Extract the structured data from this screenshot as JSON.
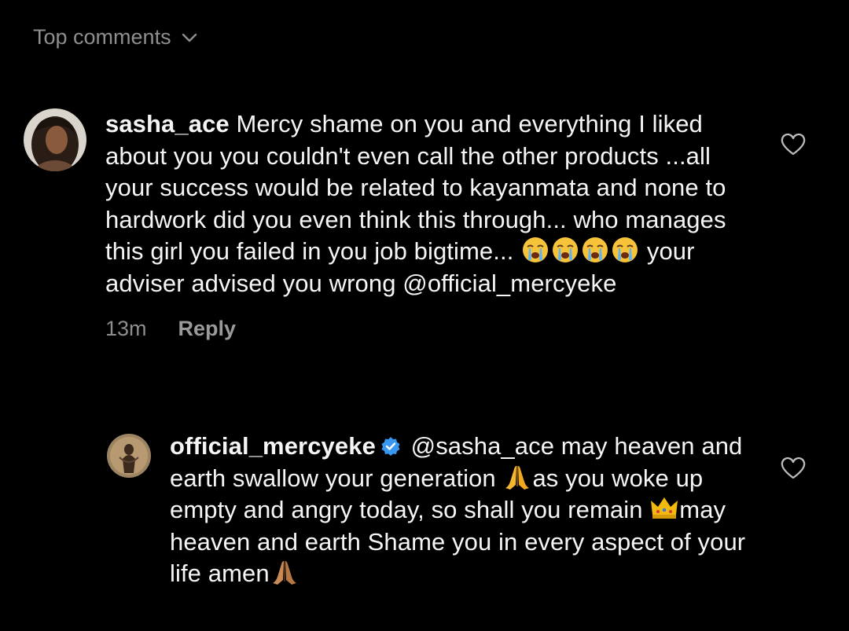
{
  "header": {
    "label": "Top comments",
    "icon": "chevron-down-icon"
  },
  "comments": [
    {
      "username": "sasha_ace",
      "segments": [
        " Mercy shame on you and everything I liked about you you couldn't even call the other products ...all your success would be related to kayanmata and none to hardwork did you even think this through... who manages this girl you failed in you job bigtime... ",
        " your adviser advised you wrong @official_mercyeke"
      ],
      "emoji": [
        "loudly-crying-face",
        "loudly-crying-face",
        "loudly-crying-face",
        "loudly-crying-face"
      ],
      "time": "13m",
      "reply_label": "Reply",
      "like_icon": "heart-outline-icon"
    },
    {
      "username": "official_mercyeke",
      "verified": true,
      "segments": [
        " @sasha_ace may heaven and earth swallow your generation ",
        "as you woke up empty and angry today, so shall you remain ",
        "may heaven and earth Shame you in every aspect of your life amen"
      ],
      "emoji": [
        "folded-hands",
        "crown",
        "folded-hands"
      ],
      "like_icon": "heart-outline-icon"
    }
  ],
  "colors": {
    "background": "#000000",
    "text": "#f5f5f5",
    "muted": "#8e8e8e",
    "verified": "#3897f0"
  }
}
